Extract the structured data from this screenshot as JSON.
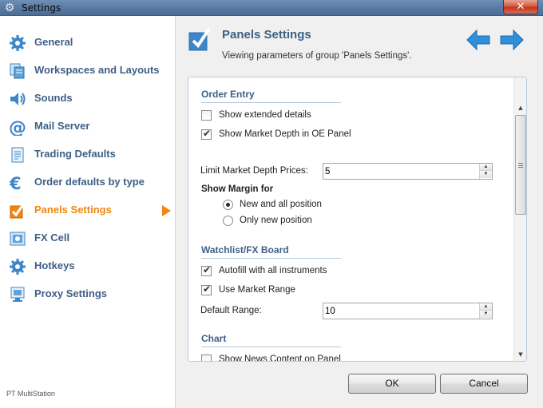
{
  "window": {
    "title": "Settings",
    "close_label": "✕"
  },
  "sidebar": {
    "items": [
      {
        "label": "General",
        "icon": "gear-icon",
        "active": false
      },
      {
        "label": "Workspaces and Layouts",
        "icon": "workspaces-icon",
        "active": false
      },
      {
        "label": "Sounds",
        "icon": "speaker-icon",
        "active": false
      },
      {
        "label": "Mail Server",
        "icon": "at-sign-icon",
        "active": false
      },
      {
        "label": "Trading Defaults",
        "icon": "document-icon",
        "active": false
      },
      {
        "label": "Order defaults by type",
        "icon": "euro-icon",
        "active": false
      },
      {
        "label": "Panels Settings",
        "icon": "checkmark-icon",
        "active": true
      },
      {
        "label": "FX Cell",
        "icon": "fx-cell-icon",
        "active": false
      },
      {
        "label": "Hotkeys",
        "icon": "hotkeys-gear-icon",
        "active": false
      },
      {
        "label": "Proxy Settings",
        "icon": "proxy-icon",
        "active": false
      }
    ],
    "footer": "PT MultiStation"
  },
  "header": {
    "title": "Panels Settings",
    "subtitle": "Viewing parameters of group 'Panels Settings'."
  },
  "sections": {
    "order_entry": {
      "title": "Order Entry",
      "show_extended_details": {
        "label": "Show extended details",
        "checked": false
      },
      "show_market_depth": {
        "label": "Show Market Depth in OE Panel",
        "checked": true
      },
      "limit_market_depth": {
        "label": "Limit Market Depth Prices:",
        "value": "5"
      },
      "show_margin_for": {
        "label": "Show Margin for",
        "options": [
          {
            "label": "New and all position",
            "selected": true
          },
          {
            "label": "Only new position",
            "selected": false
          }
        ]
      }
    },
    "watchlist": {
      "title": "Watchlist/FX Board",
      "autofill": {
        "label": "Autofill with all instruments",
        "checked": true
      },
      "use_market_range": {
        "label": "Use Market Range",
        "checked": true
      },
      "default_range": {
        "label": "Default Range:",
        "value": "10"
      }
    },
    "chart": {
      "title": "Chart",
      "show_news_content": {
        "label": "Show News Content on Panel",
        "checked": false
      }
    }
  },
  "buttons": {
    "ok": "OK",
    "cancel": "Cancel"
  },
  "colors": {
    "accent_blue": "#3e5f86",
    "active_orange": "#f0860f",
    "arrow_blue": "#2f8fd8"
  }
}
